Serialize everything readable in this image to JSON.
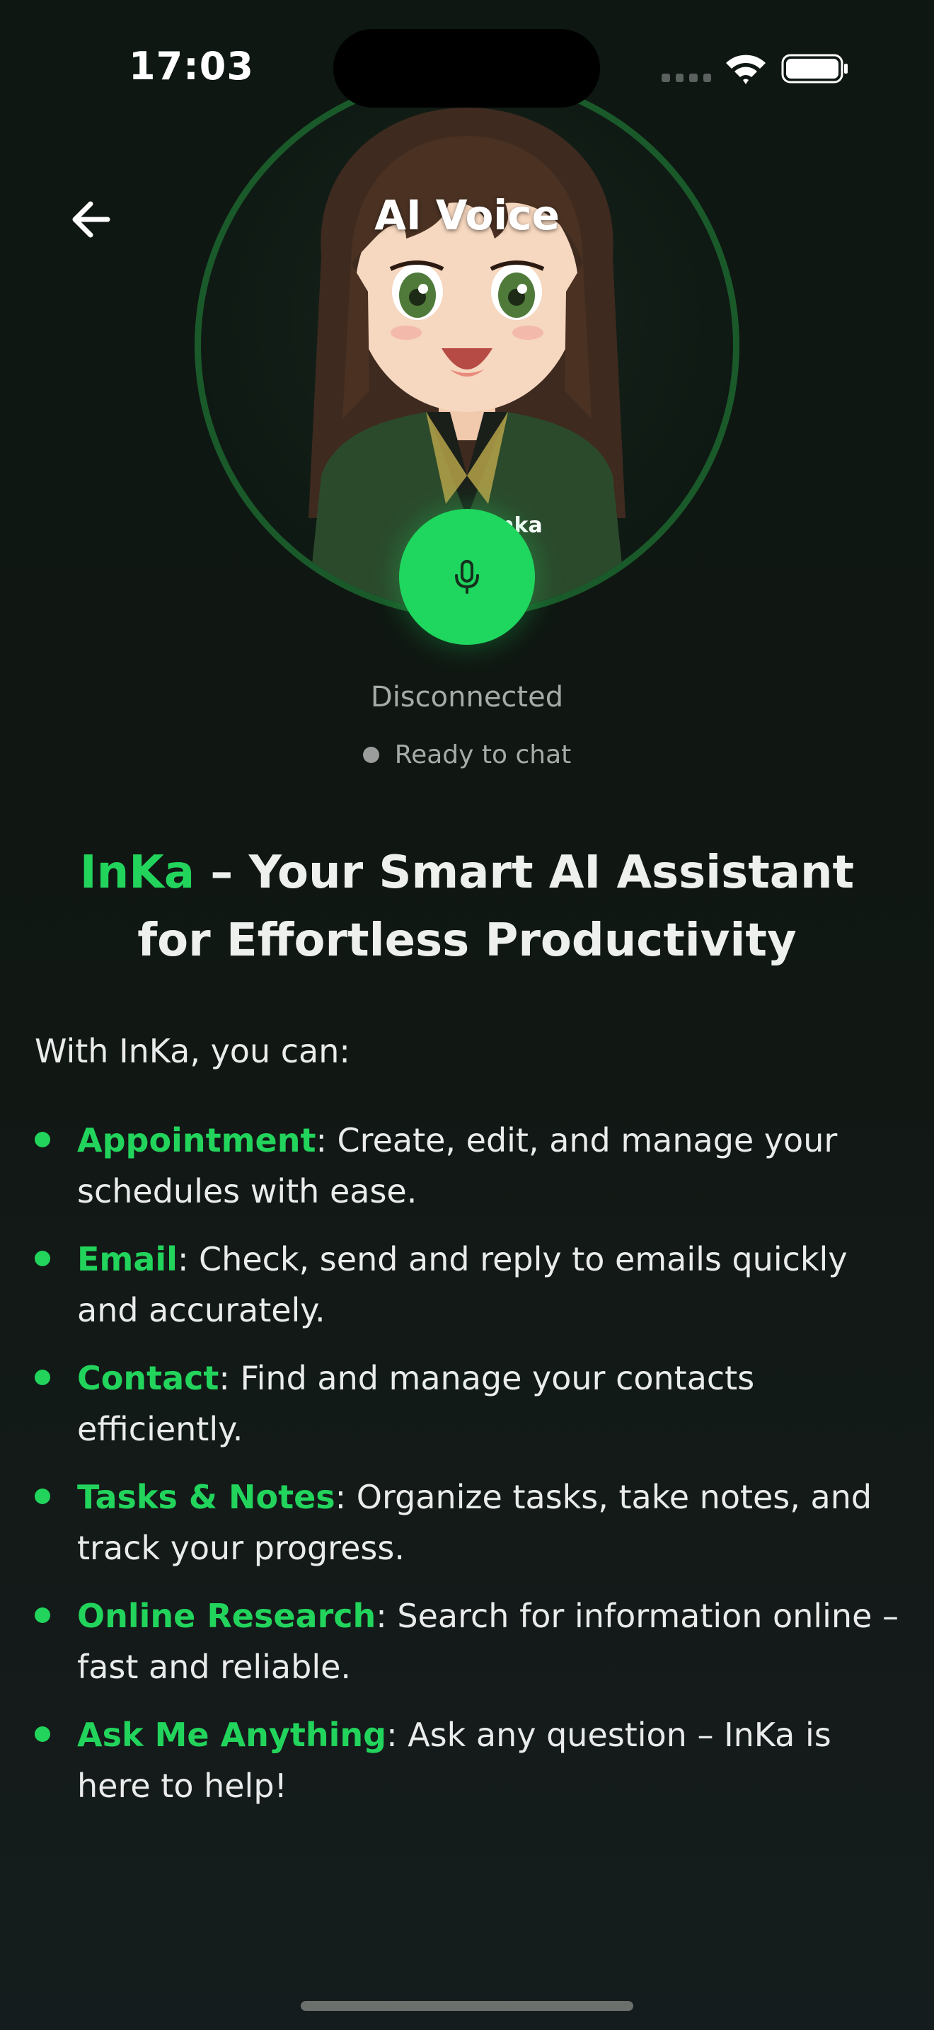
{
  "status_bar": {
    "time": "17:03"
  },
  "header": {
    "title": "AI Voice"
  },
  "avatar": {
    "badge_text": "Inka"
  },
  "voice": {
    "connection_state": "Disconnected",
    "ready_text": "Ready to chat",
    "accent_color": "#1fd65e"
  },
  "headline": {
    "brand": "InKa",
    "rest": " – Your Smart AI Assistant for Effortless Productivity"
  },
  "intro": "With InKa, you can:",
  "features": [
    {
      "name": "Appointment",
      "desc": ": Create, edit, and manage your schedules with ease."
    },
    {
      "name": "Email",
      "desc": ": Check, send and reply to emails quickly and accurately."
    },
    {
      "name": "Contact",
      "desc": ": Find and manage your contacts efficiently."
    },
    {
      "name": "Tasks & Notes",
      "desc": ": Organize tasks, take notes, and track your progress."
    },
    {
      "name": "Online Research",
      "desc": ": Search for information online – fast and reliable."
    },
    {
      "name": "Ask Me Anything",
      "desc": ": Ask any question – InKa is here to help!"
    }
  ],
  "icons": {
    "back": "arrow-left-icon",
    "mic": "microphone-icon",
    "wifi": "wifi-icon",
    "battery": "battery-icon"
  }
}
